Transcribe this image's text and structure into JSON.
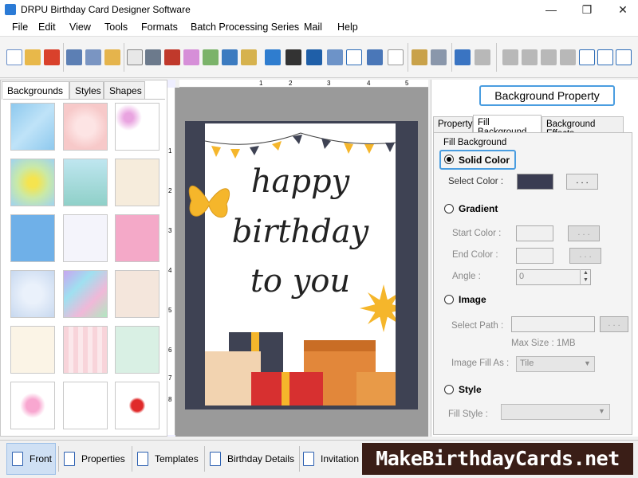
{
  "window": {
    "title": "DRPU Birthday Card Designer Software",
    "minimize": "—",
    "restore": "❐",
    "close": "✕"
  },
  "menu": [
    "File",
    "Edit",
    "View",
    "Tools",
    "Formats",
    "Batch Processing Series",
    "Mail",
    "Help"
  ],
  "left_panel": {
    "tabs": [
      "Backgrounds",
      "Styles",
      "Shapes"
    ],
    "active_tab": "Backgrounds"
  },
  "ruler": {
    "top_marks": [
      "1",
      "2",
      "3",
      "4",
      "5"
    ],
    "left_marks": [
      "1",
      "2",
      "3",
      "4",
      "5",
      "6",
      "7",
      "8"
    ]
  },
  "card": {
    "line1": "happy",
    "line2": "birthday",
    "line3": "to  you"
  },
  "right_panel": {
    "header_button": "Background Property",
    "tabs": [
      "Property",
      "Fill Background",
      "Background Effects"
    ],
    "active_tab": "Fill Background",
    "group_label": "Fill Background",
    "solid_color": "Solid Color",
    "select_color": "Select Color :",
    "selected_color_hex": "#3a3c52",
    "dots": ". . .",
    "gradient": "Gradient",
    "start_color": "Start Color :",
    "end_color": "End Color :",
    "angle": "Angle :",
    "angle_value": "0",
    "image": "Image",
    "select_path": "Select Path :",
    "max_size": "Max Size : 1MB",
    "image_fill_as": "Image Fill As :",
    "image_fill_value": "Tile",
    "style": "Style",
    "fill_style": "Fill Style :"
  },
  "bottom_tabs": [
    "Front",
    "Properties",
    "Templates",
    "Birthday Details",
    "Invitation"
  ],
  "brand": "MakeBirthdayCards.net",
  "colors": {
    "accent": "#4a9de0",
    "card_frame": "#3e4253",
    "brand_bg": "#3a1e17"
  }
}
